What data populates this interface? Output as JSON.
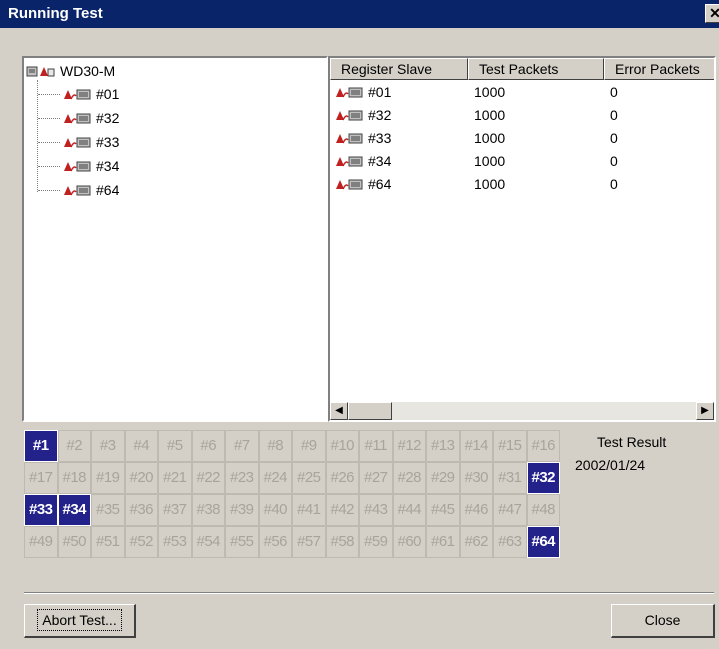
{
  "window": {
    "title": "Running Test",
    "close_glyph": "✕"
  },
  "tree": {
    "root": {
      "label": "WD30-M",
      "icon": "master-device-icon"
    },
    "items": [
      {
        "label": "#01",
        "icon": "slave-device-icon"
      },
      {
        "label": "#32",
        "icon": "slave-device-icon"
      },
      {
        "label": "#33",
        "icon": "slave-device-icon"
      },
      {
        "label": "#34",
        "icon": "slave-device-icon"
      },
      {
        "label": "#64",
        "icon": "slave-device-icon"
      }
    ]
  },
  "list": {
    "columns": [
      "Register Slave",
      "Test Packets",
      "Error Packets"
    ],
    "rows": [
      {
        "slave": "#01",
        "packets": "1000",
        "errors": "0"
      },
      {
        "slave": "#32",
        "packets": "1000",
        "errors": "0"
      },
      {
        "slave": "#33",
        "packets": "1000",
        "errors": "0"
      },
      {
        "slave": "#34",
        "packets": "1000",
        "errors": "0"
      },
      {
        "slave": "#64",
        "packets": "1000",
        "errors": "0"
      }
    ]
  },
  "slots": {
    "labels": [
      "#1",
      "#2",
      "#3",
      "#4",
      "#5",
      "#6",
      "#7",
      "#8",
      "#9",
      "#10",
      "#11",
      "#12",
      "#13",
      "#14",
      "#15",
      "#16",
      "#17",
      "#18",
      "#19",
      "#20",
      "#21",
      "#22",
      "#23",
      "#24",
      "#25",
      "#26",
      "#27",
      "#28",
      "#29",
      "#30",
      "#31",
      "#32",
      "#33",
      "#34",
      "#35",
      "#36",
      "#37",
      "#38",
      "#39",
      "#40",
      "#41",
      "#42",
      "#43",
      "#44",
      "#45",
      "#46",
      "#47",
      "#48",
      "#49",
      "#50",
      "#51",
      "#52",
      "#53",
      "#54",
      "#55",
      "#56",
      "#57",
      "#58",
      "#59",
      "#60",
      "#61",
      "#62",
      "#63",
      "#64"
    ],
    "active": [
      "#1",
      "#32",
      "#33",
      "#34",
      "#64"
    ],
    "active_color": "#23218a"
  },
  "result": {
    "label": "Test Result",
    "date": "2002/01/24"
  },
  "buttons": {
    "abort": "Abort Test...",
    "close": "Close"
  }
}
